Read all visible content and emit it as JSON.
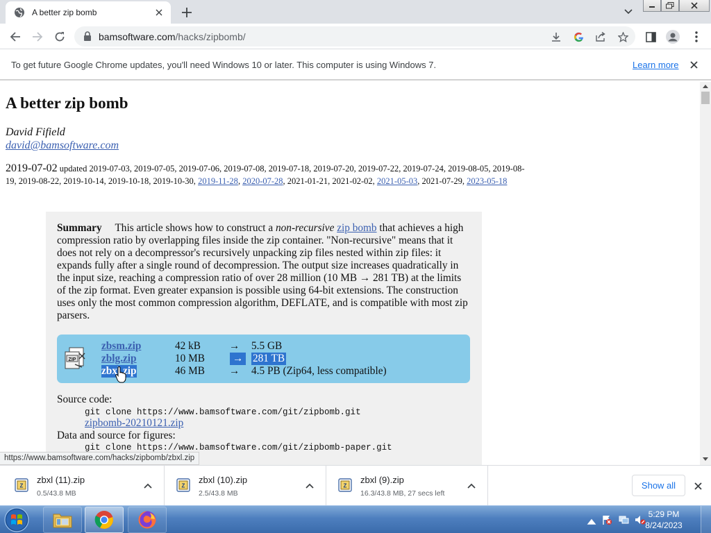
{
  "browser": {
    "tab_title": "A better zip bomb",
    "url_domain": "bamsoftware.com",
    "url_path": "/hacks/zipbomb/",
    "status_url": "https://www.bamsoftware.com/hacks/zipbomb/zbxl.zip"
  },
  "infobar": {
    "message": "To get future Google Chrome updates, you'll need Windows 10 or later. This computer is using Windows 7.",
    "learn_more": "Learn more"
  },
  "article": {
    "title": "A better zip bomb",
    "author": "David Fifield",
    "email": "david@bamsoftware.com",
    "pub_date": "2019-07-02",
    "updated_label": "updated",
    "updated_dates_plain_1": "2019-07-03, 2019-07-05, 2019-07-06, 2019-07-08, 2019-07-18, 2019-07-20, 2019-07-22, 2019-07-24, 2019-08-05, 2019-08-19, 2019-08-22, 2019-10-14, 2019-10-18, 2019-10-30,",
    "updated_link_1": "2019-11-28",
    "updated_link_2": "2020-07-28",
    "updated_dates_plain_2": ", 2021-01-21, 2021-02-02,",
    "updated_link_3": "2021-05-03",
    "updated_dates_plain_3": ", 2021-07-29,",
    "updated_link_4": "2023-05-18",
    "summary_label": "Summary",
    "summary_part1": "This article shows how to construct a",
    "summary_em": "non-recursive",
    "summary_link": "zip bomb",
    "summary_part2": "that achieves a high compression ratio by overlapping files inside the zip container. \"Non-recursive\" means that it does not rely on a decompressor's recursively unpacking zip files nested within zip files: it expands fully after a single round of decompression. The output size increases quadratically in the input size, reaching a compression ratio of over 28 million (10 MB → 281 TB) at the limits of the zip format. Even greater expansion is possible using 64-bit extensions. The construction uses only the most common compression algorithm, DEFLATE, and is compatible with most zip parsers.",
    "files": [
      {
        "name": "zbsm.zip",
        "compressed": "42 kB",
        "arrow": "→",
        "uncompressed": "5.5 GB"
      },
      {
        "name": "zblg.zip",
        "compressed": "10 MB",
        "arrow": "→",
        "uncompressed": "281 TB"
      },
      {
        "name": "zbxl.zip",
        "compressed": "46 MB",
        "arrow": "→",
        "uncompressed": "4.5 PB (Zip64, less compatible)"
      }
    ],
    "source_label": "Source code:",
    "source_cmd": "git clone https://www.bamsoftware.com/git/zipbomb.git",
    "source_zip": "zipbomb-20210121.zip",
    "figures_label": "Data and source for figures:",
    "figures_cmd": "git clone https://www.bamsoftware.com/git/zipbomb-paper.git"
  },
  "downloads": [
    {
      "name": "zbxl (11).zip",
      "status": "0.5/43.8 MB"
    },
    {
      "name": "zbxl (10).zip",
      "status": "2.5/43.8 MB"
    },
    {
      "name": "zbxl (9).zip",
      "status": "16.3/43.8 MB, 27 secs left"
    }
  ],
  "show_all": "Show all",
  "taskbar": {
    "time": "5:29 PM",
    "date": "8/24/2023"
  },
  "colors": {
    "link": "#3a5fb0",
    "highlight_box": "#87cbe9",
    "selection": "#2e74cf",
    "taskbar": "#4e7fbf"
  }
}
